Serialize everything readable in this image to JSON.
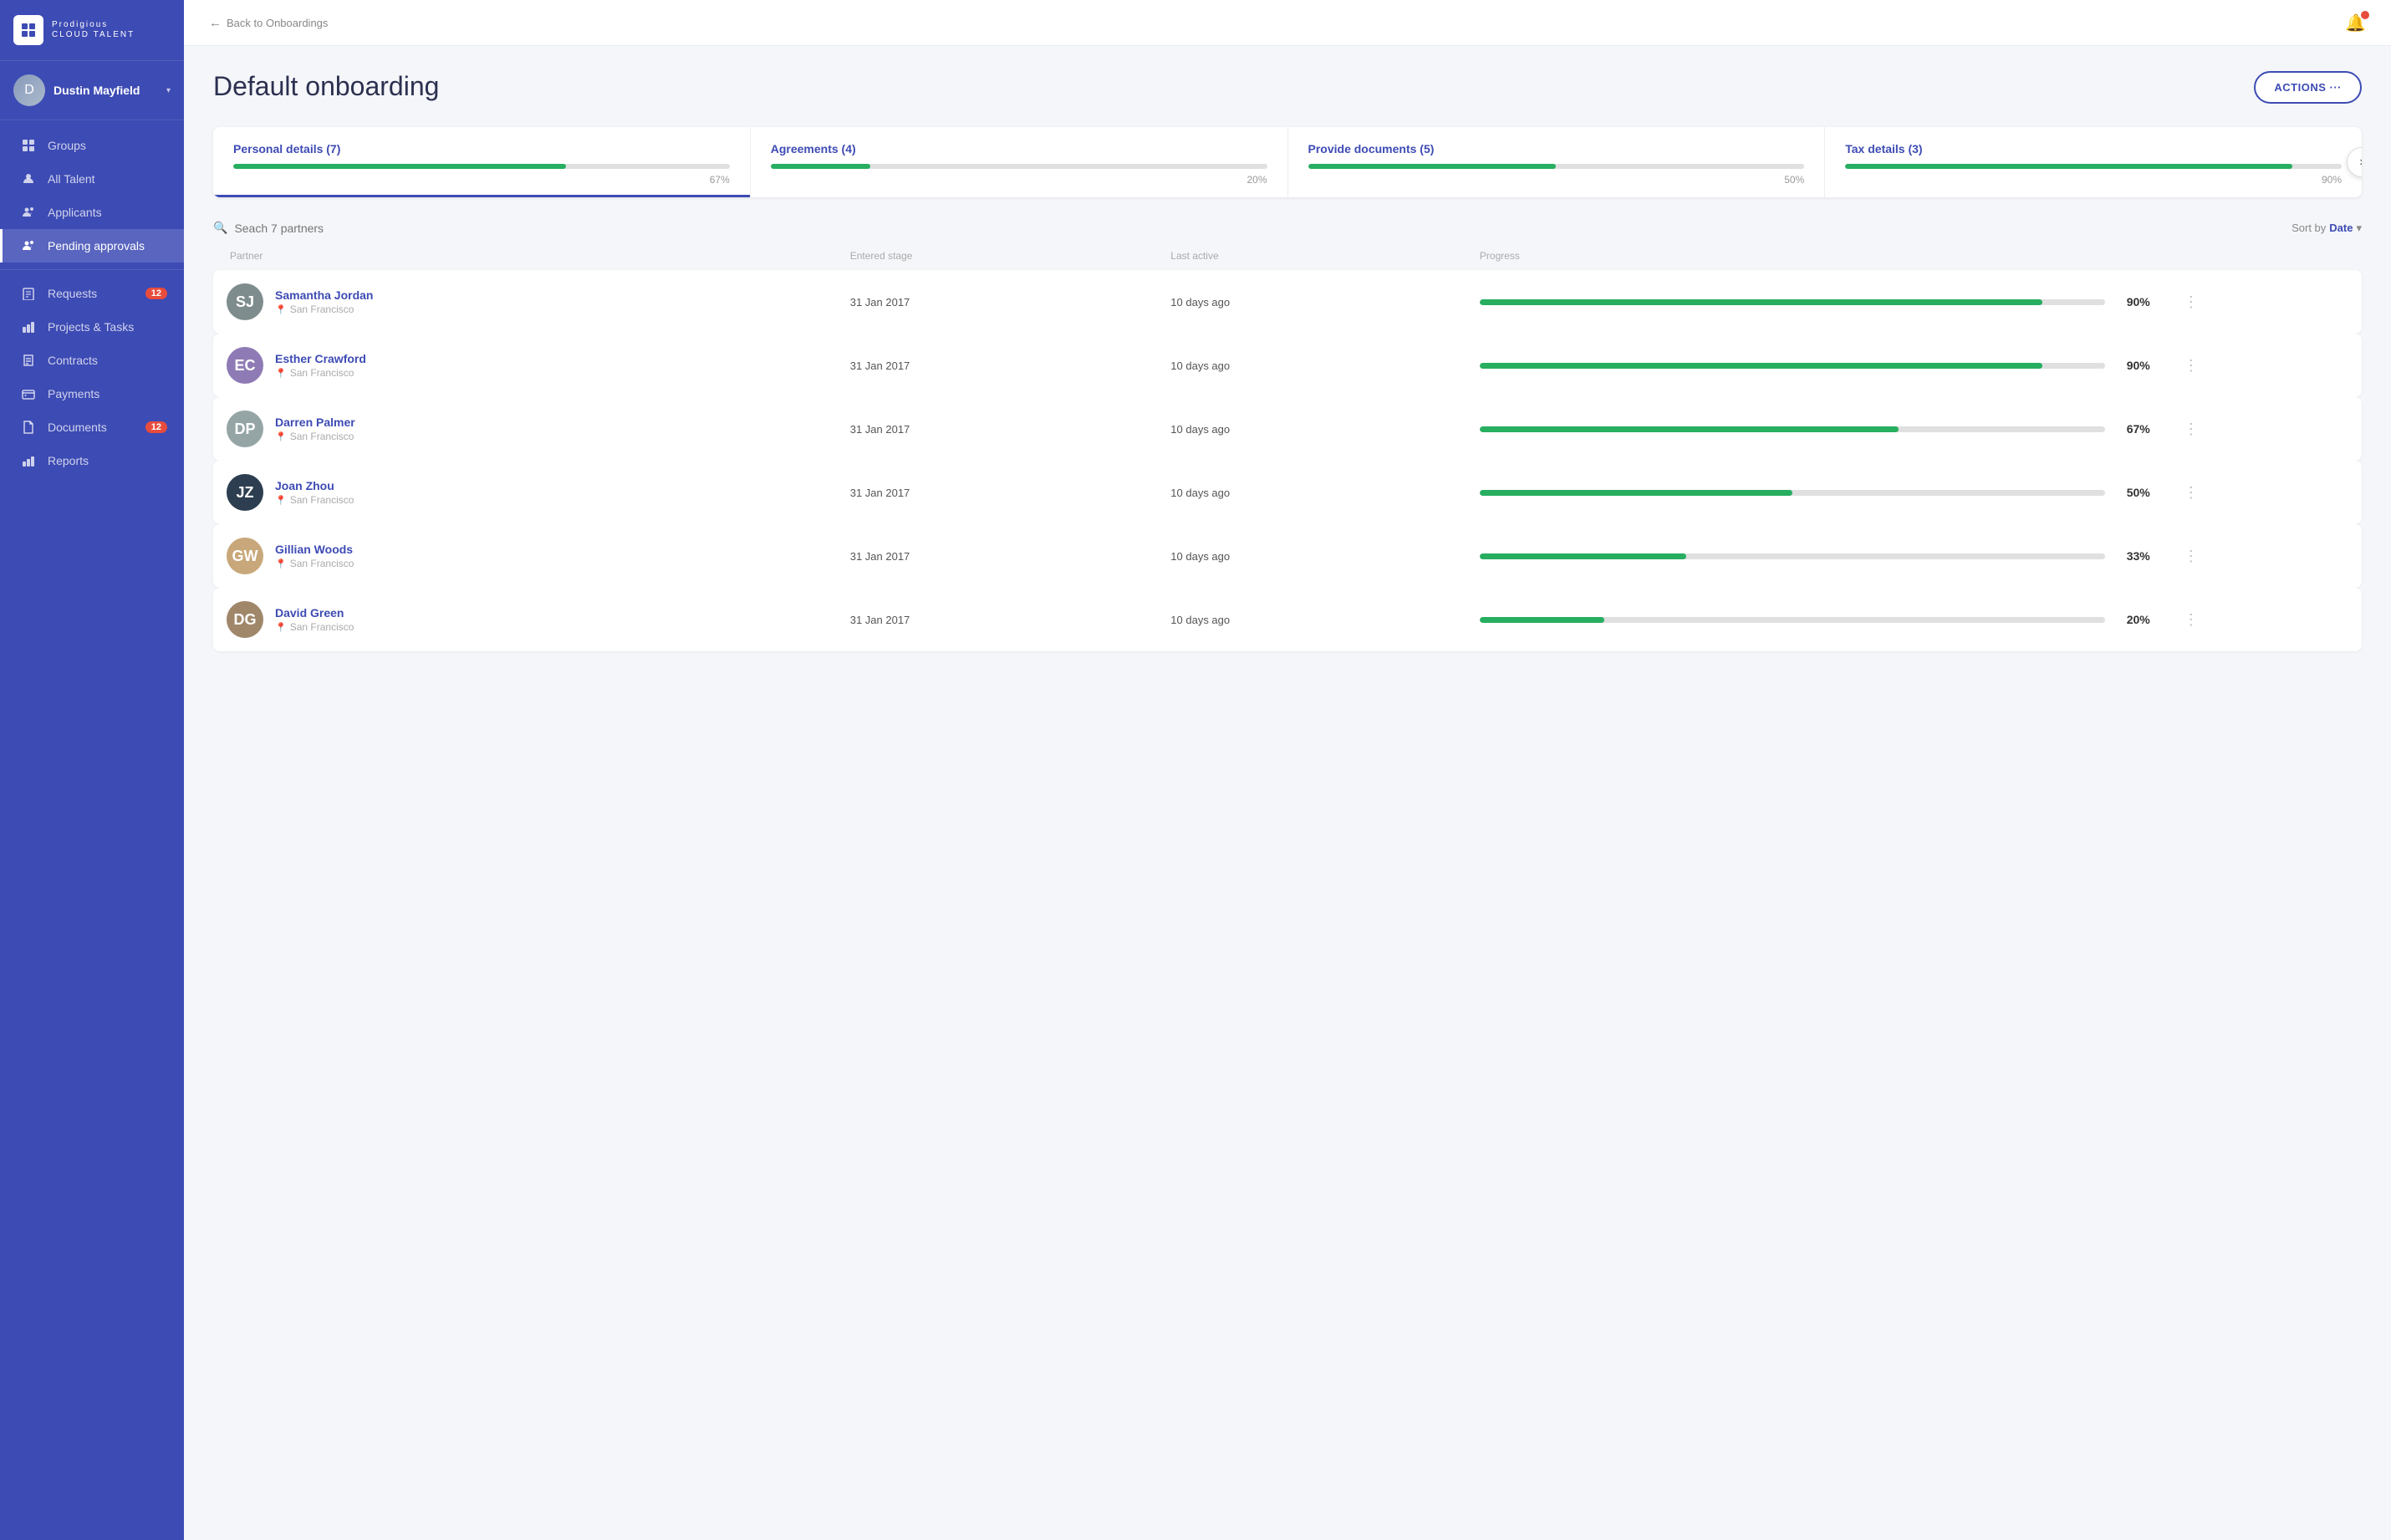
{
  "app": {
    "logo_text": "Prodigious",
    "logo_sub": "CLOUD TALENT"
  },
  "user": {
    "name": "Dustin Mayfield",
    "avatar_initial": "D"
  },
  "sidebar": {
    "nav_items": [
      {
        "id": "groups",
        "label": "Groups",
        "icon": "⊞",
        "badge": null,
        "active": false
      },
      {
        "id": "all-talent",
        "label": "All Talent",
        "icon": "👤",
        "badge": null,
        "active": false
      },
      {
        "id": "applicants",
        "label": "Applicants",
        "icon": "👥",
        "badge": null,
        "active": false
      },
      {
        "id": "pending-approvals",
        "label": "Pending approvals",
        "icon": "👥",
        "badge": null,
        "active": true
      }
    ],
    "nav_items2": [
      {
        "id": "requests",
        "label": "Requests",
        "icon": "🗂",
        "badge": "12",
        "active": false
      },
      {
        "id": "projects-tasks",
        "label": "Projects & Tasks",
        "icon": "💼",
        "badge": null,
        "active": false
      },
      {
        "id": "contracts",
        "label": "Contracts",
        "icon": "✏️",
        "badge": null,
        "active": false
      },
      {
        "id": "payments",
        "label": "Payments",
        "icon": "💲",
        "badge": null,
        "active": false
      },
      {
        "id": "documents",
        "label": "Documents",
        "icon": "📄",
        "badge": "12",
        "active": false
      },
      {
        "id": "reports",
        "label": "Reports",
        "icon": "📊",
        "badge": null,
        "active": false
      }
    ]
  },
  "topbar": {
    "back_label": "Back to Onboardings"
  },
  "page": {
    "title": "Default onboarding",
    "actions_label": "ACTIONS ···"
  },
  "stage_cards": [
    {
      "id": "personal-details",
      "title": "Personal details (7)",
      "percent": 67,
      "active": true
    },
    {
      "id": "agreements",
      "title": "Agreements (4)",
      "percent": 20,
      "active": false
    },
    {
      "id": "provide-documents",
      "title": "Provide documents (5)",
      "percent": 50,
      "active": false
    },
    {
      "id": "tax-details",
      "title": "Tax details (3)",
      "percent": 90,
      "active": false
    }
  ],
  "list": {
    "search_placeholder": "Seach 7 partners",
    "sort_label": "Sort by",
    "sort_value": "Date",
    "columns": [
      "Partner",
      "",
      "Entered stage",
      "Last active",
      "Progress"
    ]
  },
  "partners": [
    {
      "id": 1,
      "name": "Samantha Jordan",
      "location": "San Francisco",
      "entered_stage": "31 Jan 2017",
      "last_active": "10 days ago",
      "progress": 90,
      "avatar_color": "#7f8c8d"
    },
    {
      "id": 2,
      "name": "Esther Crawford",
      "location": "San Francisco",
      "entered_stage": "31 Jan 2017",
      "last_active": "10 days ago",
      "progress": 90,
      "avatar_color": "#8e7bb5"
    },
    {
      "id": 3,
      "name": "Darren Palmer",
      "location": "San Francisco",
      "entered_stage": "31 Jan 2017",
      "last_active": "10 days ago",
      "progress": 67,
      "avatar_color": "#95a5a6"
    },
    {
      "id": 4,
      "name": "Joan Zhou",
      "location": "San Francisco",
      "entered_stage": "31 Jan 2017",
      "last_active": "10 days ago",
      "progress": 50,
      "avatar_color": "#2c3e50"
    },
    {
      "id": 5,
      "name": "Gillian Woods",
      "location": "San Francisco",
      "entered_stage": "31 Jan 2017",
      "last_active": "10 days ago",
      "progress": 33,
      "avatar_color": "#c8a87a"
    },
    {
      "id": 6,
      "name": "David Green",
      "location": "San Francisco",
      "entered_stage": "31 Jan 2017",
      "last_active": "10 days ago",
      "progress": 20,
      "avatar_color": "#a0876a"
    }
  ]
}
